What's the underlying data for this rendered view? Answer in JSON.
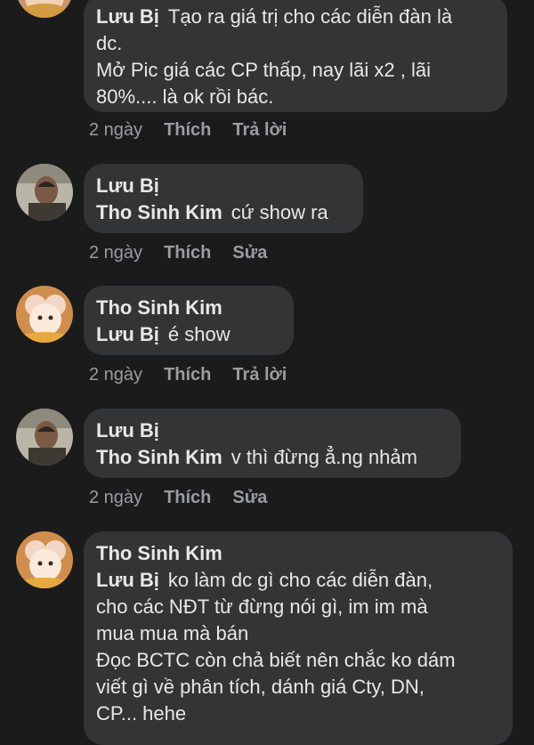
{
  "comments": [
    {
      "mention": "Lưu Bị",
      "lines": [
        "Tạo ra giá trị cho các diễn đàn là",
        "dc.",
        "Mở Pic giá các CP thấp, nay lãi x2 , lãi",
        "80%.... là ok rồi bác."
      ],
      "time": "2 ngày",
      "like": "Thích",
      "action": "Trả lời"
    },
    {
      "author": "Lưu Bị",
      "mention": "Tho Sinh Kim",
      "text": "cứ show ra",
      "time": "2 ngày",
      "like": "Thích",
      "action": "Sửa"
    },
    {
      "author": "Tho Sinh Kim",
      "mention": "Lưu Bị",
      "text": "é show",
      "time": "2 ngày",
      "like": "Thích",
      "action": "Trả lời"
    },
    {
      "author": "Lưu Bị",
      "mention": "Tho Sinh Kim",
      "text": "v thì đừng ẳ.ng nhảm",
      "time": "2 ngày",
      "like": "Thích",
      "action": "Sửa"
    },
    {
      "author": "Tho Sinh Kim",
      "mention": "Lưu Bị",
      "lines": [
        "ko làm dc gì cho các diễn đàn,",
        "cho các NĐT từ đừng nói gì, im im mà",
        "mua mua mà bán",
        "Đọc BCTC còn chả biết nên chắc ko dám",
        "viết gì về phân tích, dánh giá Cty, DN,",
        "CP... hehe"
      ]
    }
  ]
}
